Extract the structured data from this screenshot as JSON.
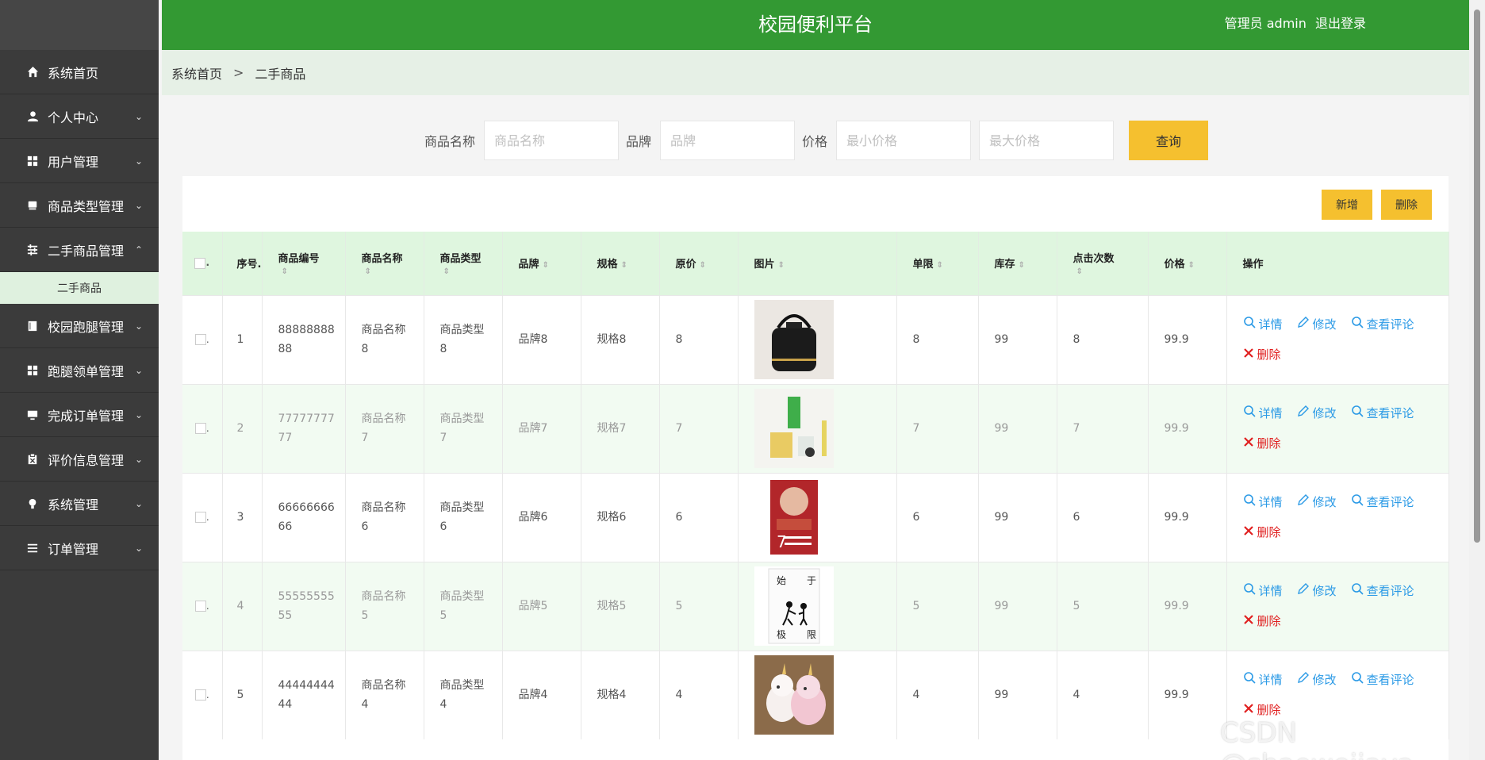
{
  "header": {
    "title": "校园便利平台",
    "user_label": "管理员 admin",
    "logout_label": "退出登录"
  },
  "sidebar": {
    "items": [
      {
        "label": "系统首页",
        "icon": "home-icon"
      },
      {
        "label": "个人中心",
        "icon": "user-icon"
      },
      {
        "label": "用户管理",
        "icon": "grid-icon"
      },
      {
        "label": "商品类型管理",
        "icon": "box-icon"
      },
      {
        "label": "二手商品管理",
        "icon": "sliders-icon"
      },
      {
        "label": "校园跑腿管理",
        "icon": "book-icon"
      },
      {
        "label": "跑腿领单管理",
        "icon": "grid-icon"
      },
      {
        "label": "完成订单管理",
        "icon": "monitor-icon"
      },
      {
        "label": "评价信息管理",
        "icon": "clipboard-icon"
      },
      {
        "label": "系统管理",
        "icon": "bulb-icon"
      },
      {
        "label": "订单管理",
        "icon": "list-icon"
      }
    ],
    "sub_item": "二手商品"
  },
  "breadcrumb": {
    "home": "系统首页",
    "separator": ">",
    "current": "二手商品"
  },
  "filter": {
    "name_label": "商品名称",
    "name_placeholder": "商品名称",
    "brand_label": "品牌",
    "brand_placeholder": "品牌",
    "price_label": "价格",
    "min_placeholder": "最小价格",
    "max_placeholder": "最大价格",
    "query_label": "查询"
  },
  "toolbar": {
    "add_label": "新增",
    "delete_label": "删除"
  },
  "table": {
    "headers": {
      "index": "序号.",
      "code": "商品编号",
      "name": "商品名称",
      "type": "商品类型",
      "brand": "品牌",
      "spec": "规格",
      "orig_price": "原价",
      "image": "图片",
      "limit": "单限",
      "stock": "库存",
      "clicks": "点击次数",
      "price": "价格",
      "ops": "操作"
    },
    "ops": {
      "detail": "详情",
      "edit": "修改",
      "comments": "查看评论",
      "delete": "删除"
    },
    "rows": [
      {
        "index": "1",
        "code": "8888888888",
        "name": "商品名称8",
        "type": "商品类型8",
        "brand": "品牌8",
        "spec": "规格8",
        "orig_price": "8",
        "image": "black-bag",
        "limit": "8",
        "stock": "99",
        "clicks": "8",
        "price": "99.9"
      },
      {
        "index": "2",
        "code": "7777777777",
        "name": "商品名称7",
        "type": "商品类型7",
        "brand": "品牌7",
        "spec": "规格7",
        "orig_price": "7",
        "image": "tea-glass",
        "limit": "7",
        "stock": "99",
        "clicks": "7",
        "price": "99.9"
      },
      {
        "index": "3",
        "code": "6666666666",
        "name": "商品名称6",
        "type": "商品类型6",
        "brand": "品牌6",
        "spec": "规格6",
        "orig_price": "6",
        "image": "red-book",
        "limit": "6",
        "stock": "99",
        "clicks": "6",
        "price": "99.9"
      },
      {
        "index": "4",
        "code": "5555555555",
        "name": "商品名称5",
        "type": "商品类型5",
        "brand": "品牌5",
        "spec": "规格5",
        "orig_price": "5",
        "image": "white-book",
        "limit": "5",
        "stock": "99",
        "clicks": "5",
        "price": "99.9"
      },
      {
        "index": "5",
        "code": "4444444444",
        "name": "商品名称4",
        "type": "商品类型4",
        "brand": "品牌4",
        "spec": "规格4",
        "orig_price": "4",
        "image": "unicorn-toy",
        "limit": "4",
        "stock": "99",
        "clicks": "4",
        "price": "99.9"
      }
    ]
  },
  "watermark": "CSDN @shaoweijava",
  "colors": {
    "header_green": "#339933",
    "sidebar_dark": "#3b3b3b",
    "button_yellow": "#f5c02f",
    "link_blue": "#2b9ae6",
    "delete_red": "#e02020",
    "row_alt": "#f2fbf2"
  }
}
